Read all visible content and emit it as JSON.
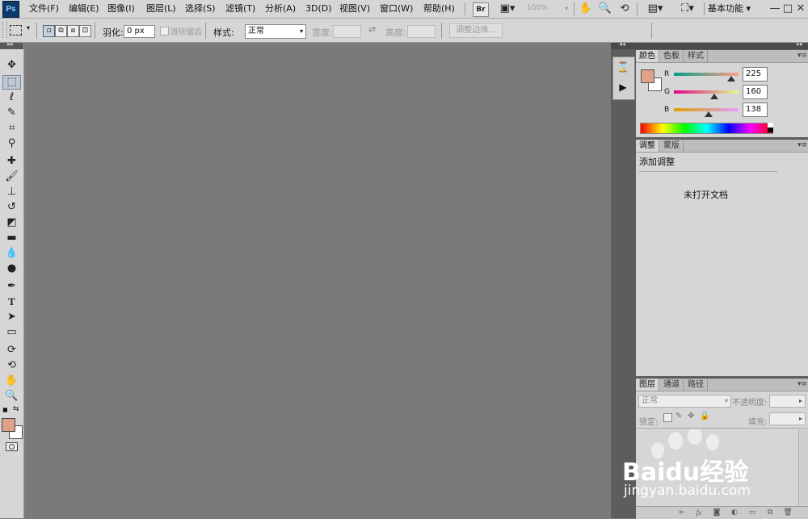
{
  "app": {
    "logo": "Ps"
  },
  "menubar": {
    "items": [
      "文件(F)",
      "编辑(E)",
      "图像(I)",
      "图层(L)",
      "选择(S)",
      "滤镜(T)",
      "分析(A)",
      "3D(D)",
      "视图(V)",
      "窗口(W)",
      "帮助(H)"
    ],
    "bridge_label": "Br",
    "zoom": "100%",
    "workspace": "基本功能",
    "window_controls": [
      "—",
      "□",
      "✕"
    ]
  },
  "options_bar": {
    "feather_label": "羽化:",
    "feather_value": "0 px",
    "antialias_label": "消除锯齿",
    "style_label": "样式:",
    "style_value": "正常",
    "width_label": "宽度:",
    "height_label": "高度:",
    "refine_edge": "调整边缘..."
  },
  "color_panel": {
    "tabs": [
      "颜色",
      "色板",
      "样式"
    ],
    "foreground": "#e1a08a",
    "background": "#ffffff",
    "channels": [
      {
        "label": "R",
        "value": "225"
      },
      {
        "label": "G",
        "value": "160"
      },
      {
        "label": "B",
        "value": "138"
      }
    ]
  },
  "adjustments_panel": {
    "tabs": [
      "调整",
      "蒙版"
    ],
    "title": "添加调整",
    "empty_message": "未打开文档"
  },
  "layers_panel": {
    "tabs": [
      "图层",
      "通道",
      "路径"
    ],
    "blend_mode": "正常",
    "opacity_label": "不透明度:",
    "lock_label": "锁定:",
    "fill_label": "填充:"
  },
  "watermark": {
    "text": "Baidu经验",
    "sub": "jingyan.baidu.com"
  }
}
